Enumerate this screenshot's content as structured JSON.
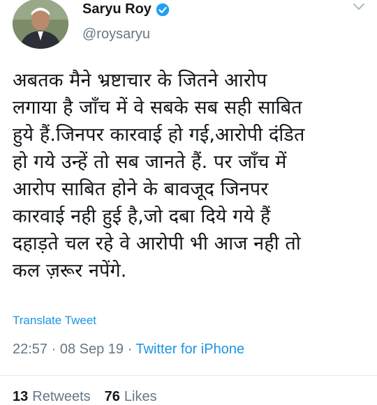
{
  "author": {
    "display_name": "Saryu Roy",
    "handle": "@roysaryu",
    "verified_icon": "verified-badge-icon"
  },
  "tweet": {
    "text": "अबतक मैने भ्रष्टाचार के जितने आरोप\nलगाया है जाँच में वे सबके सब सही साबित\nहुये हैं.जिनपर कारवाई हो गई,आरोपी दंडित\nहो गये उन्हें तो सब जानते हैं. पर जाँच में\nआरोप साबित होने के बावजूद जिनपर\nकारवाई नही हुई है,जो दबा दिये गये हैं\nदहाड़ते चल रहे वे आरोपी भी आज नही तो\nकल ज़रूर नपेंगे.",
    "translate_label": "Translate Tweet",
    "time": "22:57",
    "separator1": " · ",
    "date": "08 Sep 19",
    "separator2": " · ",
    "source": "Twitter for iPhone"
  },
  "stats": {
    "retweets_count": "13",
    "retweets_label": "Retweets",
    "likes_count": "76",
    "likes_label": "Likes"
  },
  "colors": {
    "link": "#1b95e0",
    "muted": "#657786",
    "text": "#14171a",
    "verified": "#1da1f2"
  }
}
